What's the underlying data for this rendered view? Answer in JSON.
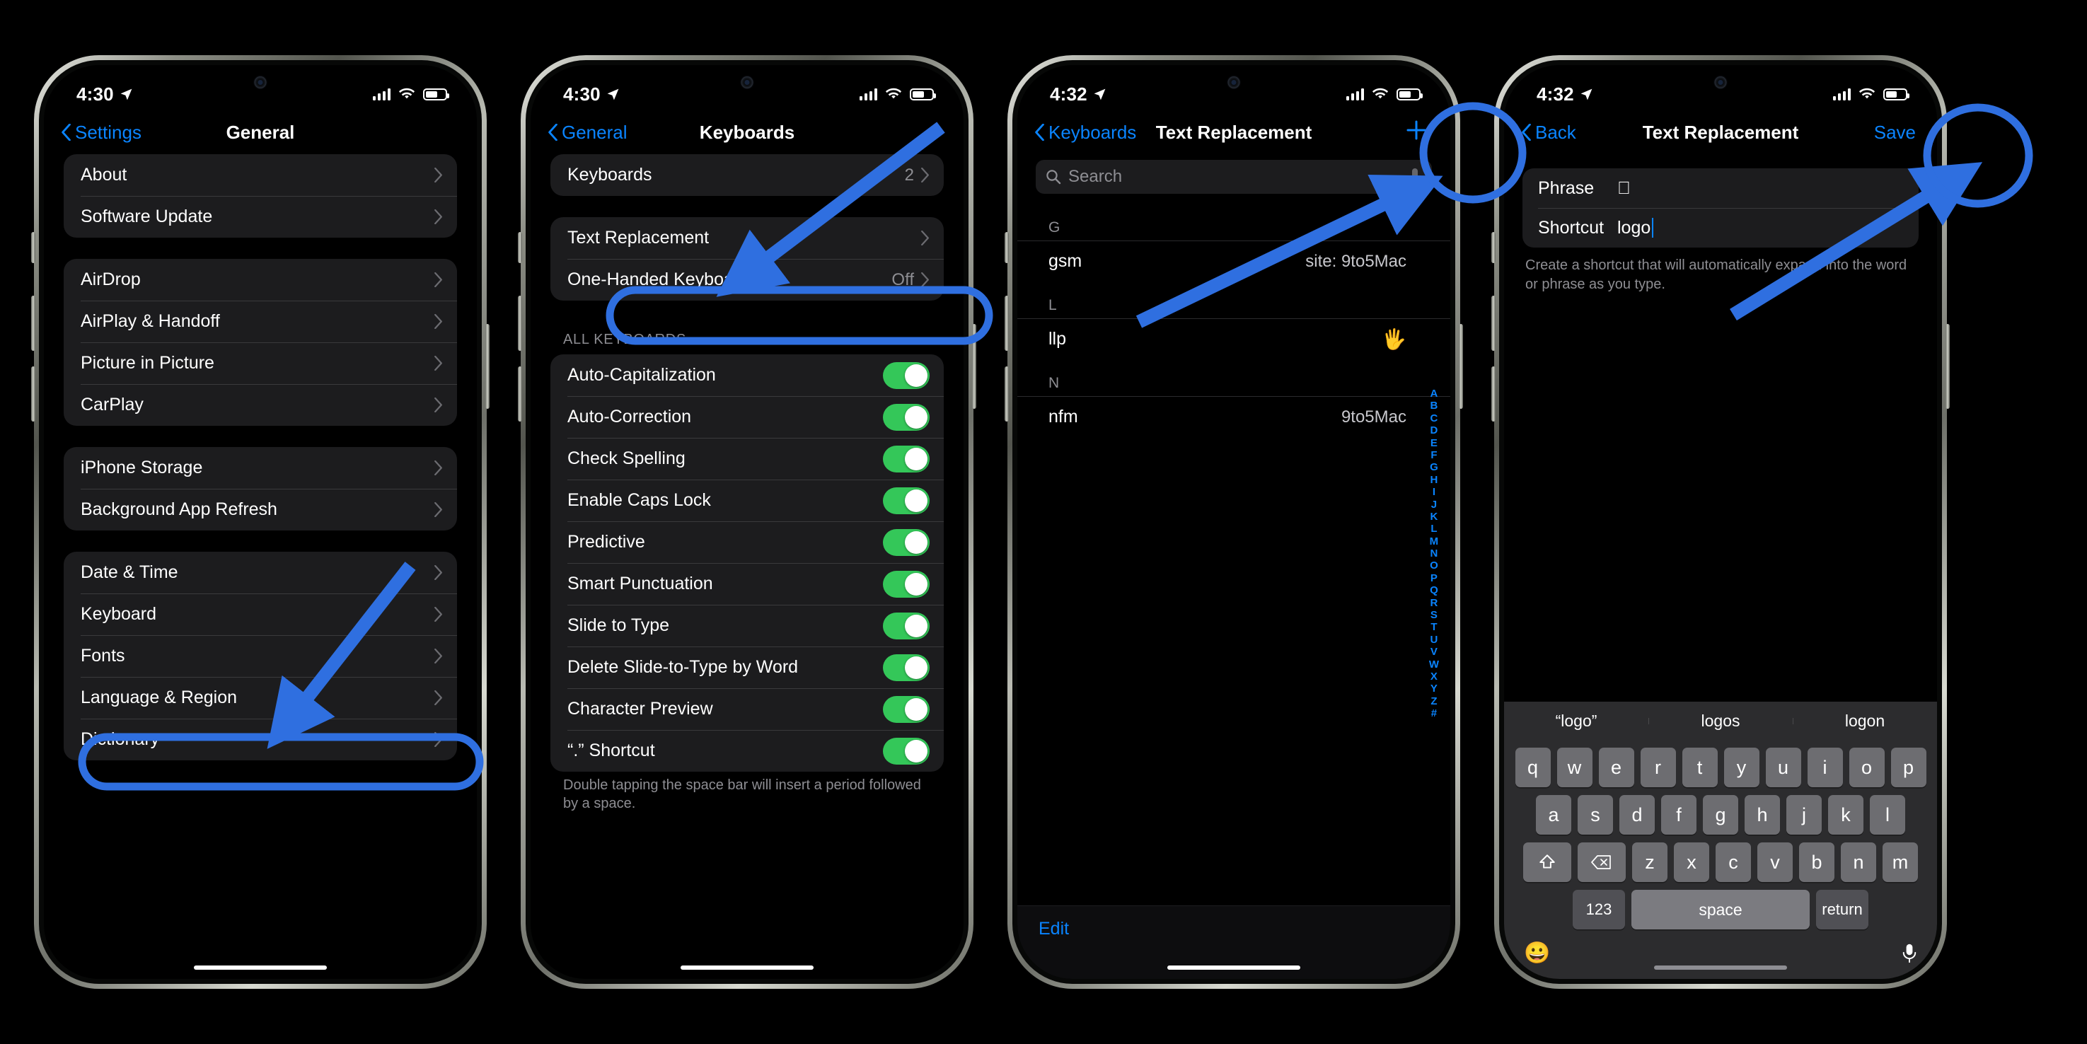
{
  "accent": "#0a84ff",
  "annotation_color": "#2f6fe0",
  "toggle_on_color": "#34c759",
  "phones": [
    {
      "id": "phone-general",
      "status": {
        "time": "4:30",
        "location_icon": "location-arrow-icon",
        "signal_icon": "cellular-signal-icon",
        "wifi_icon": "wifi-icon",
        "battery_icon": "battery-icon"
      },
      "nav": {
        "back": "Settings",
        "title": "General"
      },
      "groups": [
        {
          "rows": [
            {
              "label": "About",
              "value": "",
              "chevron": true
            },
            {
              "label": "Software Update",
              "value": "",
              "chevron": true
            }
          ]
        },
        {
          "rows": [
            {
              "label": "AirDrop",
              "value": "",
              "chevron": true
            },
            {
              "label": "AirPlay & Handoff",
              "value": "",
              "chevron": true
            },
            {
              "label": "Picture in Picture",
              "value": "",
              "chevron": true
            },
            {
              "label": "CarPlay",
              "value": "",
              "chevron": true
            }
          ]
        },
        {
          "rows": [
            {
              "label": "iPhone Storage",
              "value": "",
              "chevron": true
            },
            {
              "label": "Background App Refresh",
              "value": "",
              "chevron": true
            }
          ]
        },
        {
          "rows": [
            {
              "label": "Date & Time",
              "value": "",
              "chevron": true
            },
            {
              "label": "Keyboard",
              "value": "",
              "chevron": true,
              "highlighted": true
            },
            {
              "label": "Fonts",
              "value": "",
              "chevron": true
            },
            {
              "label": "Language & Region",
              "value": "",
              "chevron": true
            },
            {
              "label": "Dictionary",
              "value": "",
              "chevron": true
            }
          ]
        }
      ]
    },
    {
      "id": "phone-keyboards",
      "status": {
        "time": "4:30"
      },
      "nav": {
        "back": "General",
        "title": "Keyboards"
      },
      "groups": [
        {
          "rows": [
            {
              "label": "Keyboards",
              "value": "2",
              "chevron": true
            }
          ]
        },
        {
          "rows": [
            {
              "label": "Text Replacement",
              "value": "",
              "chevron": true,
              "highlighted": true
            },
            {
              "label": "One-Handed Keyboard",
              "value": "Off",
              "chevron": true
            }
          ]
        }
      ],
      "all_keyboards_header": "ALL KEYBOARDS",
      "toggles": [
        {
          "label": "Auto-Capitalization",
          "on": true
        },
        {
          "label": "Auto-Correction",
          "on": true
        },
        {
          "label": "Check Spelling",
          "on": true
        },
        {
          "label": "Enable Caps Lock",
          "on": true
        },
        {
          "label": "Predictive",
          "on": true
        },
        {
          "label": "Smart Punctuation",
          "on": true
        },
        {
          "label": "Slide to Type",
          "on": true
        },
        {
          "label": "Delete Slide-to-Type by Word",
          "on": true
        },
        {
          "label": "Character Preview",
          "on": true
        },
        {
          "label": "“.” Shortcut",
          "on": true
        }
      ],
      "footer": "Double tapping the space bar will insert a period followed by a space."
    },
    {
      "id": "phone-text-replacement-list",
      "status": {
        "time": "4:32"
      },
      "nav": {
        "back": "Keyboards",
        "title": "Text Replacement",
        "right_icon": "plus-icon"
      },
      "search": {
        "placeholder": "Search",
        "icon": "search-icon",
        "dictation_icon": "microphone-icon"
      },
      "sections": [
        {
          "letter": "G",
          "rows": [
            {
              "shortcut": "gsm",
              "phrase": "site: 9to5Mac"
            }
          ]
        },
        {
          "letter": "L",
          "rows": [
            {
              "shortcut": "llp",
              "phrase": "🖐️"
            }
          ]
        },
        {
          "letter": "N",
          "rows": [
            {
              "shortcut": "nfm",
              "phrase": "9to5Mac"
            }
          ]
        }
      ],
      "index": [
        "A",
        "B",
        "C",
        "D",
        "E",
        "F",
        "G",
        "H",
        "I",
        "J",
        "K",
        "L",
        "M",
        "N",
        "O",
        "P",
        "Q",
        "R",
        "S",
        "T",
        "U",
        "V",
        "W",
        "X",
        "Y",
        "Z",
        "#"
      ],
      "edit_label": "Edit"
    },
    {
      "id": "phone-new-text-replacement",
      "status": {
        "time": "4:32"
      },
      "nav": {
        "back": "Back",
        "title": "Text Replacement",
        "right_label": "Save"
      },
      "form": [
        {
          "key": "Phrase",
          "value": ""
        },
        {
          "key": "Shortcut",
          "value": "logo",
          "has_caret": true
        }
      ],
      "form_footer": "Create a shortcut that will automatically expand into the word or phrase as you type.",
      "keyboard": {
        "predictions": [
          "“logo”",
          "logos",
          "logon"
        ],
        "row1": [
          "q",
          "w",
          "e",
          "r",
          "t",
          "y",
          "u",
          "i",
          "o",
          "p"
        ],
        "row2": [
          "a",
          "s",
          "d",
          "f",
          "g",
          "h",
          "j",
          "k",
          "l"
        ],
        "row3": [
          "z",
          "x",
          "c",
          "v",
          "b",
          "n",
          "m"
        ],
        "shift_icon": "shift-icon",
        "backspace_icon": "backspace-icon",
        "numbers_key": "123",
        "space_key": "space",
        "return_key": "return",
        "emoji_icon": "emoji-icon",
        "dictation_icon": "microphone-icon"
      }
    }
  ]
}
